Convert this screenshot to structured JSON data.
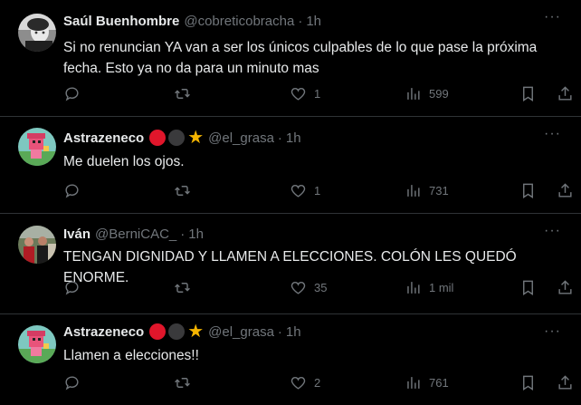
{
  "tweets": [
    {
      "name": "Saúl Buenhombre",
      "handle": "@cobreticobracha",
      "time": "1h",
      "text": "Si no renuncian YA van a ser los únicos culpables de lo que pase la próxima fecha. Esto ya no da para un minuto mas",
      "likes": "1",
      "views": "599",
      "avatar": "grayscale-portrait"
    },
    {
      "name": "Astrazeneco",
      "handle": "@el_grasa",
      "time": "1h",
      "text": "Me duelen los ojos.",
      "likes": "1",
      "views": "731",
      "avatar": "pink-pixel-character"
    },
    {
      "name": "Iván",
      "handle": "@BerniCAC_",
      "time": "1h",
      "text": "TENGAN DIGNIDAD Y LLAMEN A ELECCIONES. COLÓN LES QUEDÓ ENORME.",
      "likes": "35",
      "views": "1 mil",
      "avatar": "group-photo"
    },
    {
      "name": "Astrazeneco",
      "handle": "@el_grasa",
      "time": "1h",
      "text": "Llamen a elecciones!!",
      "likes": "2",
      "views": "761",
      "avatar": "pink-pixel-character"
    }
  ],
  "ui": {
    "dot": "·",
    "more": "···",
    "badge_colors": [
      "#e0162b",
      "#3a3a3c",
      "#f4b400"
    ]
  }
}
